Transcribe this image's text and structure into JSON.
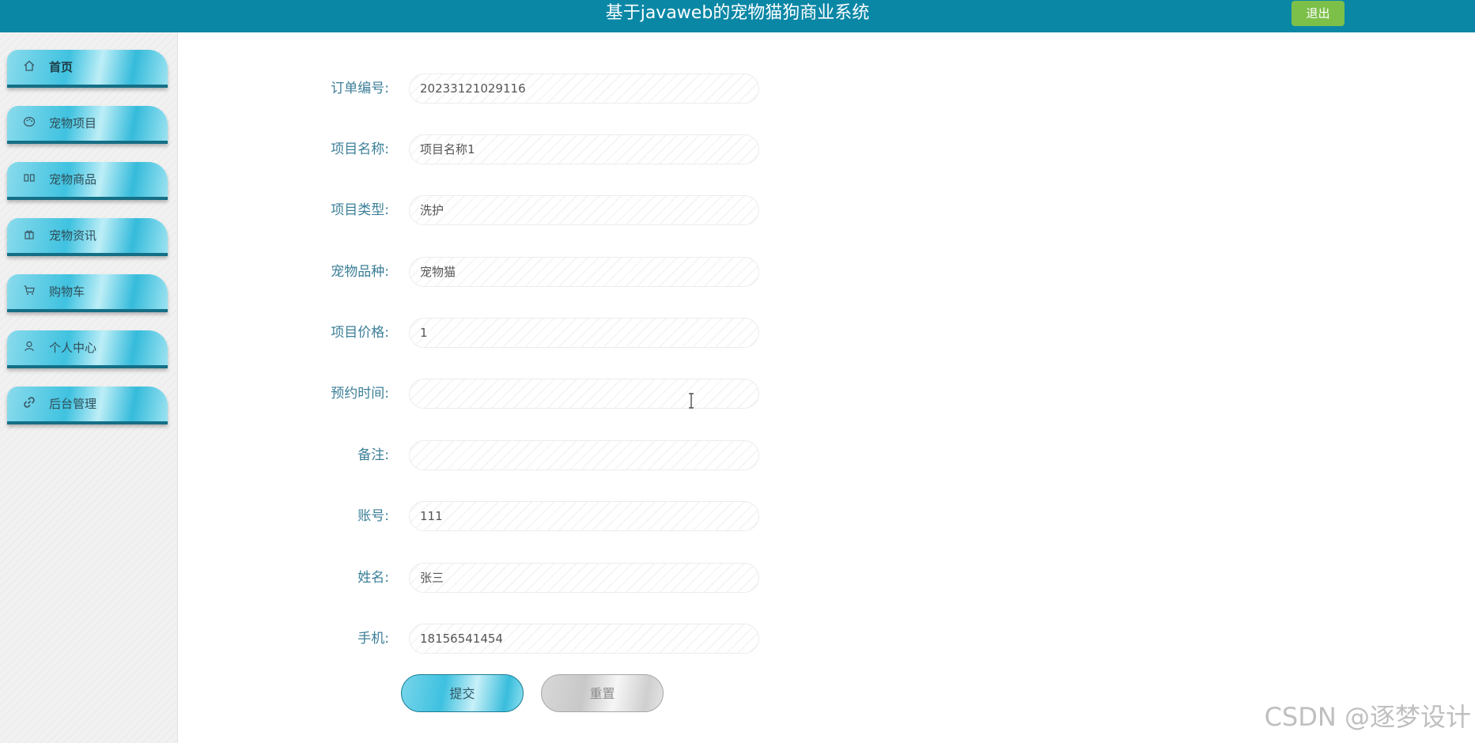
{
  "header": {
    "title": "基于javaweb的宠物猫狗商业系统",
    "logout_label": "退出"
  },
  "sidebar": {
    "items": [
      {
        "label": "首页",
        "icon": "home-icon",
        "active": true
      },
      {
        "label": "宠物项目",
        "icon": "palette-icon"
      },
      {
        "label": "宠物商品",
        "icon": "columns-icon"
      },
      {
        "label": "宠物资讯",
        "icon": "gift-icon"
      },
      {
        "label": "购物车",
        "icon": "cart-icon"
      },
      {
        "label": "个人中心",
        "icon": "user-icon"
      },
      {
        "label": "后台管理",
        "icon": "link-icon"
      }
    ]
  },
  "form": {
    "fields": [
      {
        "label": "订单编号:",
        "value": "20233121029116"
      },
      {
        "label": "项目名称:",
        "value": "项目名称1"
      },
      {
        "label": "项目类型:",
        "value": "洗护"
      },
      {
        "label": "宠物品种:",
        "value": "宠物猫"
      },
      {
        "label": "项目价格:",
        "value": "1"
      },
      {
        "label": "预约时间:",
        "value": ""
      },
      {
        "label": "备注:",
        "value": ""
      },
      {
        "label": "账号:",
        "value": "111"
      },
      {
        "label": "姓名:",
        "value": "张三"
      },
      {
        "label": "手机:",
        "value": "18156541454"
      }
    ],
    "submit_label": "提交",
    "reset_label": "重置"
  },
  "watermark": "CSDN @逐梦设计",
  "colors": {
    "header_bg": "#0b87a6",
    "logout_bg": "#7cc04a",
    "label_color": "#3c7f98",
    "nav_accent": "#3fc2e0"
  }
}
